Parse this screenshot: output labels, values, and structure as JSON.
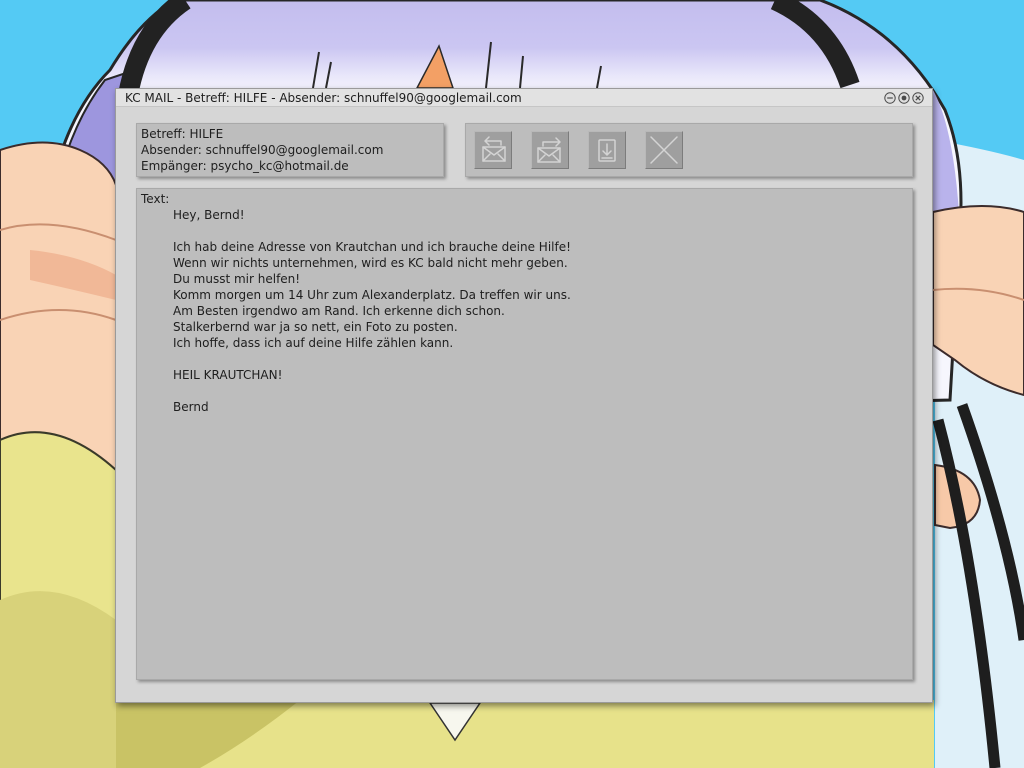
{
  "window": {
    "title": "KC MAIL - Betreff: HILFE - Absender: schnuffel90@googlemail.com",
    "controls": [
      {
        "icon": "minimize-icon"
      },
      {
        "icon": "maximize-icon"
      },
      {
        "icon": "close-icon"
      }
    ]
  },
  "header": {
    "subject_label": "Betreff:",
    "subject": "HILFE",
    "sender_label": "Absender:",
    "sender": "schnuffel90@googlemail.com",
    "recipient_label": "Empänger:",
    "recipient": "psycho_kc@hotmail.de"
  },
  "toolbar": {
    "buttons": [
      {
        "icon": "reply-icon"
      },
      {
        "icon": "forward-icon"
      },
      {
        "icon": "save-download-icon"
      },
      {
        "icon": "delete-icon"
      }
    ]
  },
  "message": {
    "label": "Text:",
    "paragraphs": [
      [
        "Hey, Bernd!"
      ],
      [
        "Ich hab deine Adresse von Krautchan und ich brauche deine Hilfe!",
        "Wenn wir nichts unternehmen, wird es KC bald nicht mehr geben.",
        "Du musst mir helfen!",
        "Komm morgen um 14 Uhr zum Alexanderplatz. Da treffen wir uns.",
        "Am Besten irgendwo am Rand. Ich erkenne dich schon.",
        "Stalkerbernd war ja so nett, ein Foto zu posten.",
        "Ich hoffe, dass ich auf deine Hilfe zählen kann."
      ],
      [
        "HEIL KRAUTCHAN!"
      ],
      [
        "Bernd"
      ]
    ]
  },
  "theme": {
    "window_bg": "#d6d6d6",
    "title_bar_bg": "#e2e2e2",
    "panel_bg": "#bdbdbd",
    "button_bg": "#9f9f9f",
    "text": "#1e1e1e",
    "icon_stroke": "#d4d4d4",
    "desktop_background": "#54caf4"
  }
}
